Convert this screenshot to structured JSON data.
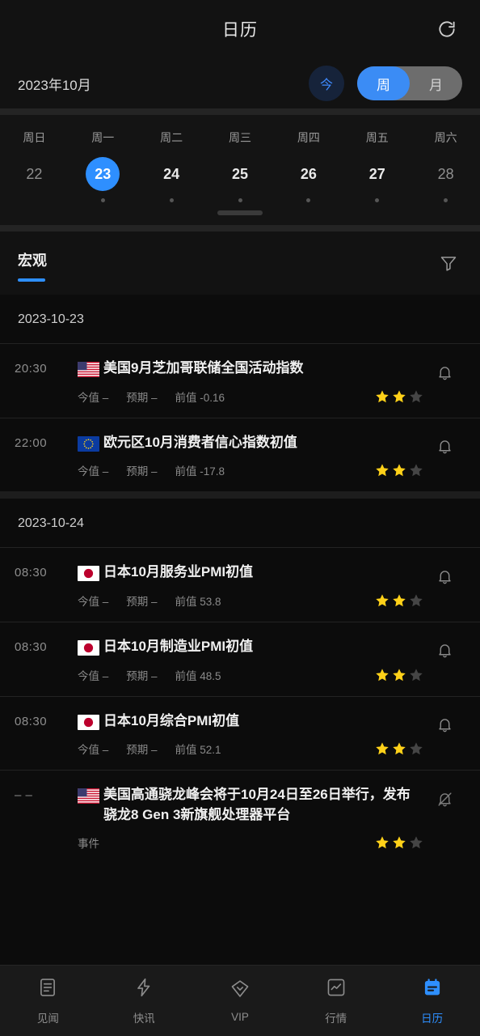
{
  "header": {
    "title": "日历",
    "refresh_icon": "refresh-icon"
  },
  "monthbar": {
    "month_label": "2023年10月",
    "today_label": "今",
    "segments": [
      {
        "label": "周",
        "active": true
      },
      {
        "label": "月",
        "active": false
      }
    ]
  },
  "week": {
    "dow": [
      "周日",
      "周一",
      "周二",
      "周三",
      "周四",
      "周五",
      "周六"
    ],
    "days": [
      {
        "num": "22",
        "selected": false,
        "dim": true,
        "dot": false
      },
      {
        "num": "23",
        "selected": true,
        "dim": false,
        "dot": true
      },
      {
        "num": "24",
        "selected": false,
        "dim": false,
        "dot": true
      },
      {
        "num": "25",
        "selected": false,
        "dim": false,
        "dot": true
      },
      {
        "num": "26",
        "selected": false,
        "dim": false,
        "dot": true
      },
      {
        "num": "27",
        "selected": false,
        "dim": false,
        "dot": true
      },
      {
        "num": "28",
        "selected": false,
        "dim": true,
        "dot": true
      }
    ]
  },
  "category": {
    "tab_label": "宏观",
    "filter_icon": "filter-icon"
  },
  "groups": [
    {
      "date": "2023-10-23",
      "events": [
        {
          "time": "20:30",
          "flag": "flag-us",
          "title": "美国9月芝加哥联储全国活动指数",
          "actual_label": "今值 –",
          "forecast_label": "预期 –",
          "previous_label": "前值 -0.16",
          "stars_filled": 2,
          "stars_total": 3,
          "bell_icon": "bell-icon",
          "two_line": false
        },
        {
          "time": "22:00",
          "flag": "flag-eu",
          "title": "欧元区10月消费者信心指数初值",
          "actual_label": "今值 –",
          "forecast_label": "预期 –",
          "previous_label": "前值 -17.8",
          "stars_filled": 2,
          "stars_total": 3,
          "bell_icon": "bell-icon",
          "two_line": false
        }
      ]
    },
    {
      "date": "2023-10-24",
      "events": [
        {
          "time": "08:30",
          "flag": "flag-jp",
          "title": "日本10月服务业PMI初值",
          "actual_label": "今值 –",
          "forecast_label": "预期 –",
          "previous_label": "前值 53.8",
          "stars_filled": 2,
          "stars_total": 3,
          "bell_icon": "bell-icon",
          "two_line": false
        },
        {
          "time": "08:30",
          "flag": "flag-jp",
          "title": "日本10月制造业PMI初值",
          "actual_label": "今值 –",
          "forecast_label": "预期 –",
          "previous_label": "前值 48.5",
          "stars_filled": 2,
          "stars_total": 3,
          "bell_icon": "bell-icon",
          "two_line": false
        },
        {
          "time": "08:30",
          "flag": "flag-jp",
          "title": "日本10月综合PMI初值",
          "actual_label": "今值 –",
          "forecast_label": "预期 –",
          "previous_label": "前值 52.1",
          "stars_filled": 2,
          "stars_total": 3,
          "bell_icon": "bell-icon",
          "two_line": false
        },
        {
          "time": "– –",
          "flag": "flag-us",
          "title": "美国高通骁龙峰会将于10月24日至26日举行，发布骁龙8 Gen 3新旗舰处理器平台",
          "actual_label": "事件",
          "forecast_label": "",
          "previous_label": "",
          "stars_filled": 2,
          "stars_total": 3,
          "bell_icon": "bell-off-icon",
          "two_line": true
        }
      ]
    }
  ],
  "bottom_nav": [
    {
      "label": "见闻",
      "icon": "news-icon",
      "active": false
    },
    {
      "label": "快讯",
      "icon": "flash-icon",
      "active": false
    },
    {
      "label": "VIP",
      "icon": "diamond-icon",
      "active": false
    },
    {
      "label": "行情",
      "icon": "market-icon",
      "active": false
    },
    {
      "label": "日历",
      "icon": "calendar-icon",
      "active": true
    }
  ],
  "colors": {
    "accent": "#2e8fff",
    "star_on": "#ffd119",
    "star_off": "#454545",
    "background": "#0c0c0c",
    "surface": "#121212"
  }
}
